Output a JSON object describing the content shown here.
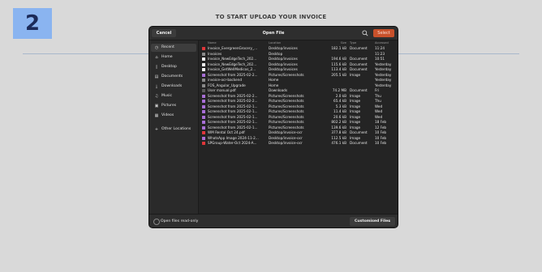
{
  "step_number": "2",
  "heading": "TO START UPLOAD YOUR INVOICE",
  "dialog": {
    "title": "Open File",
    "cancel_label": "Cancel",
    "select_label": "Select",
    "search_icon": "search-icon",
    "sidebar": [
      {
        "label": "Recent",
        "icon": "◷",
        "active": true
      },
      {
        "label": "Home",
        "icon": "⌂"
      },
      {
        "label": "Desktop",
        "icon": "▯"
      },
      {
        "label": "Documents",
        "icon": "▤"
      },
      {
        "label": "Downloads",
        "icon": "⤓"
      },
      {
        "label": "Music",
        "icon": "♫"
      },
      {
        "label": "Pictures",
        "icon": "▣"
      },
      {
        "label": "Videos",
        "icon": "▦"
      },
      {
        "label": "Other Locations",
        "icon": "+"
      }
    ],
    "columns": {
      "name": "Name",
      "location": "Location",
      "size": "Size",
      "type": "Type",
      "accessed": "Accessed"
    },
    "files": [
      {
        "name": "Invoice_EvergreenGrocery_...",
        "location": "Desktop/invoices",
        "size": "182.1 kB",
        "type": "Document",
        "accessed": "11:24",
        "kind": "pdf"
      },
      {
        "name": "Invoices",
        "location": "Desktop",
        "size": "",
        "type": "",
        "accessed": "11:23",
        "kind": "folder"
      },
      {
        "name": "Invoice_NewEdgeTech_202...",
        "location": "Desktop/invoices",
        "size": "194.6 kB",
        "type": "Document",
        "accessed": "10:51",
        "kind": "doc"
      },
      {
        "name": "Invoice_NewEdgeTech_202...",
        "location": "Desktop/invoices",
        "size": "115.6 kB",
        "type": "Document",
        "accessed": "Yesterday",
        "kind": "doc"
      },
      {
        "name": "Invoice_GetWellMedicos_2...",
        "location": "Desktop/invoices",
        "size": "113.4 kB",
        "type": "Document",
        "accessed": "Yesterday",
        "kind": "doc"
      },
      {
        "name": "Screenshot from 2025-02-2...",
        "location": "Pictures/Screenshots",
        "size": "205.5 kB",
        "type": "Image",
        "accessed": "Yesterday",
        "kind": "img"
      },
      {
        "name": "invoice-ocr-backend",
        "location": "Home",
        "size": "",
        "type": "",
        "accessed": "Yesterday",
        "kind": "folder"
      },
      {
        "name": "FOS_Angular_Upgrade",
        "location": "Home",
        "size": "",
        "type": "",
        "accessed": "Yesterday",
        "kind": "folder"
      },
      {
        "name": "User manual.pdf",
        "location": "Downloads",
        "size": "74.2 MB",
        "type": "Document",
        "accessed": "Fri",
        "kind": "pdfdark"
      },
      {
        "name": "Screenshot from 2025-02-2...",
        "location": "Pictures/Screenshots",
        "size": "2.0 kB",
        "type": "Image",
        "accessed": "Thu",
        "kind": "img"
      },
      {
        "name": "Screenshot from 2025-02-2...",
        "location": "Pictures/Screenshots",
        "size": "65.4 kB",
        "type": "Image",
        "accessed": "Thu",
        "kind": "img"
      },
      {
        "name": "Screenshot from 2025-02-1...",
        "location": "Pictures/Screenshots",
        "size": "5.3 kB",
        "type": "Image",
        "accessed": "Wed",
        "kind": "img"
      },
      {
        "name": "Screenshot from 2025-02-1...",
        "location": "Pictures/Screenshots",
        "size": "11.4 kB",
        "type": "Image",
        "accessed": "Wed",
        "kind": "img"
      },
      {
        "name": "Screenshot from 2025-02-1...",
        "location": "Pictures/Screenshots",
        "size": "20.6 kB",
        "type": "Image",
        "accessed": "Wed",
        "kind": "img"
      },
      {
        "name": "Screenshot from 2025-02-1...",
        "location": "Pictures/Screenshots",
        "size": "802.2 kB",
        "type": "Image",
        "accessed": "18 Feb",
        "kind": "img"
      },
      {
        "name": "Screenshot from 2025-02-1...",
        "location": "Pictures/Screenshots",
        "size": "139.6 kB",
        "type": "Image",
        "accessed": "12 Feb",
        "kind": "img"
      },
      {
        "name": "WM Rental Oct 24.pdf",
        "location": "Desktop/invoice-ocr",
        "size": "377.8 kB",
        "type": "Document",
        "accessed": "10 Feb",
        "kind": "pdf"
      },
      {
        "name": "WhatsApp Image 2024-11-2...",
        "location": "Desktop/invoice-ocr",
        "size": "112.5 kB",
        "type": "Image",
        "accessed": "10 Feb",
        "kind": "img"
      },
      {
        "name": "SPGroup-Water-Oct 2024-A...",
        "location": "Desktop/invoice-ocr",
        "size": "476.1 kB",
        "type": "Document",
        "accessed": "10 Feb",
        "kind": "pdf"
      }
    ],
    "read_only_label": "Open files read-only",
    "filter_label": "Customised Files",
    "filter_icon": "chevron-down-icon"
  },
  "colors": {
    "badge": "#8ab4f0",
    "select_button": "#c9512b",
    "pdf": "#e0363a",
    "folder": "#8a8a8a",
    "doc": "#f2f2f2",
    "img": "#a86fd6",
    "pdfdark": "#5a5a5a"
  }
}
